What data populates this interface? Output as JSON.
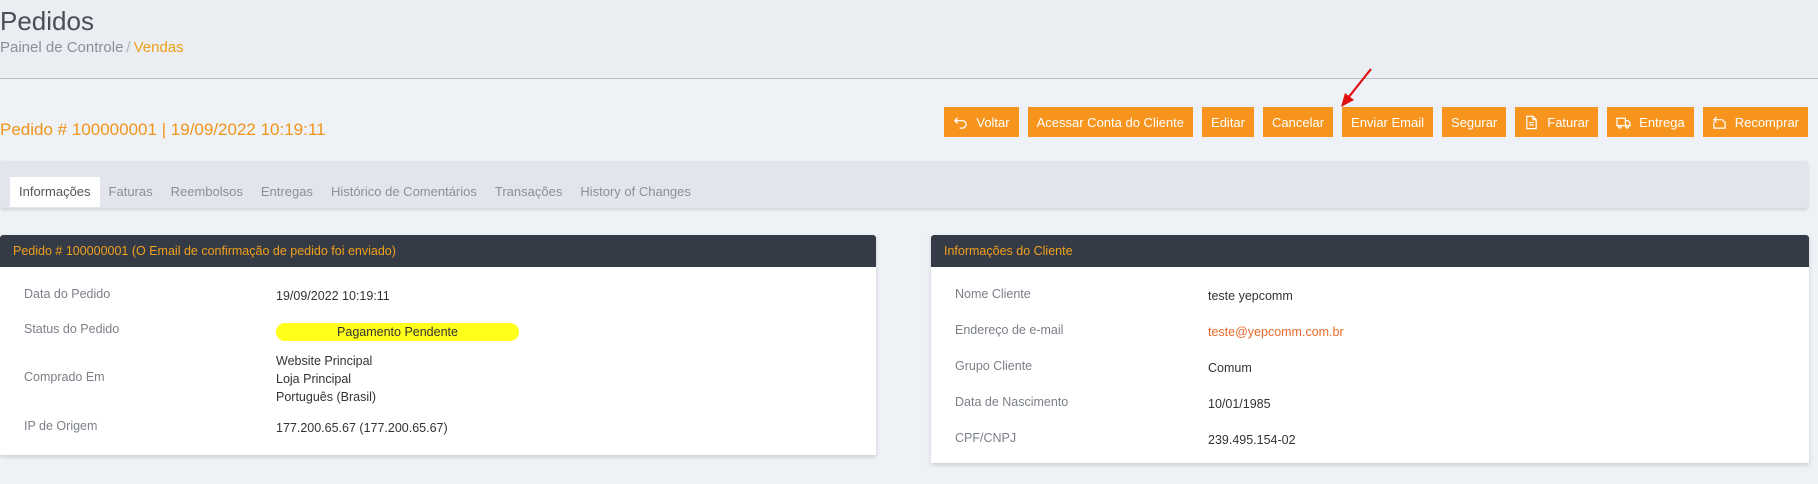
{
  "header": {
    "title": "Pedidos",
    "breadcrumb": {
      "home": "Painel de Controle",
      "separator": "/",
      "current": "Vendas"
    }
  },
  "order_title": "Pedido # 100000001 | 19/09/2022 10:19:11",
  "toolbar": {
    "buttons": [
      {
        "label": "Voltar",
        "icon": "back-arrow-icon"
      },
      {
        "label": "Acessar Conta do Cliente"
      },
      {
        "label": "Editar"
      },
      {
        "label": "Cancelar"
      },
      {
        "label": "Enviar Email"
      },
      {
        "label": "Segurar"
      },
      {
        "label": "Faturar",
        "icon": "document-icon"
      },
      {
        "label": "Entrega",
        "icon": "truck-icon"
      },
      {
        "label": "Recomprar",
        "icon": "reorder-icon"
      }
    ]
  },
  "tabs": [
    {
      "label": "Informações",
      "active": true
    },
    {
      "label": "Faturas"
    },
    {
      "label": "Reembolsos"
    },
    {
      "label": "Entregas"
    },
    {
      "label": "Histórico de Comentários"
    },
    {
      "label": "Transações"
    },
    {
      "label": "History of Changes"
    }
  ],
  "order_panel": {
    "title": "Pedido # 100000001 (O Email de confirmação de pedido foi enviado)",
    "rows": [
      {
        "label": "Data do Pedido",
        "value": "19/09/2022 10:19:11"
      },
      {
        "label": "Status do Pedido",
        "value": "Pagamento Pendente"
      },
      {
        "label": "Comprado Em",
        "lines": [
          "Website Principal",
          "Loja Principal",
          "Português (Brasil)"
        ]
      },
      {
        "label": "IP de Origem",
        "value": "177.200.65.67 (177.200.65.67)"
      }
    ]
  },
  "customer_panel": {
    "title": "Informações do Cliente",
    "rows": [
      {
        "label": "Nome Cliente",
        "value": "teste yepcomm"
      },
      {
        "label": "Endereço de e-mail",
        "value": "teste@yepcomm.com.br"
      },
      {
        "label": "Grupo Cliente",
        "value": "Comum"
      },
      {
        "label": "Data de Nascimento",
        "value": "10/01/1985"
      },
      {
        "label": "CPF/CNPJ",
        "value": "239.495.154-02"
      }
    ]
  },
  "colors": {
    "accent": "#f7941d",
    "panel_header": "#343a46",
    "status_badge": "#ffff1a",
    "annotation_arrow": "#e01010"
  }
}
